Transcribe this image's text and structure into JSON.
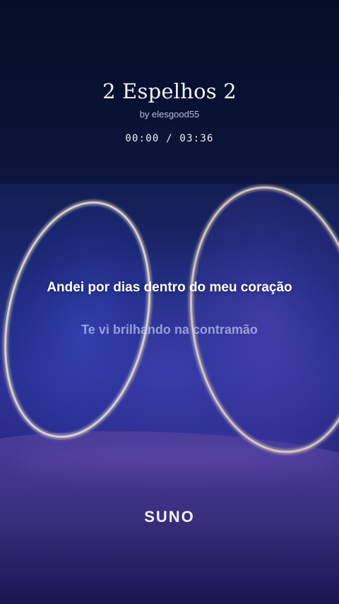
{
  "song": {
    "title": "2 Espelhos 2",
    "artist": "by elesgood55",
    "time_display": "00:00 / 03:36"
  },
  "lyrics": {
    "current_line": "Andei por dias dentro do meu coração",
    "next_line": "Te vi brilhando na contramão"
  },
  "brand": {
    "logo_text": "SUNO"
  },
  "colors": {
    "background_top": "#07102a",
    "background_mid": "#2a2f8f",
    "ring_glow": "#e8e0a0",
    "floor": "#3a2f80"
  },
  "icons": {
    "background": "two-mirror-rings-artwork"
  }
}
